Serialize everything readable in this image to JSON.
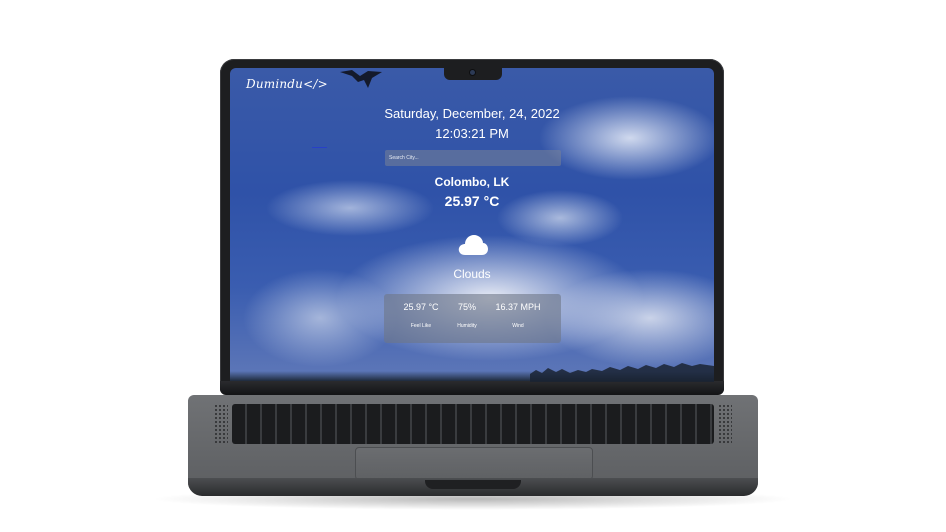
{
  "app": {
    "brand": "Dumindu</>"
  },
  "header": {
    "date": "Saturday, December, 24, 2022",
    "time": "12:03:21 PM"
  },
  "search": {
    "placeholder": "Search City...",
    "value": ""
  },
  "current": {
    "location": "Colombo, LK",
    "temperature": "25.97 °C",
    "icon": "cloud-icon",
    "condition": "Clouds"
  },
  "details": [
    {
      "value": "25.97 °C",
      "label": "Feel Like"
    },
    {
      "value": "75%",
      "label": "Humidity"
    },
    {
      "value": "16.37 MPH",
      "label": "Wind"
    }
  ],
  "theme": {
    "text_color": "#ffffff",
    "panel_color": "#6e7687",
    "sky_color": "#2f52a8"
  }
}
